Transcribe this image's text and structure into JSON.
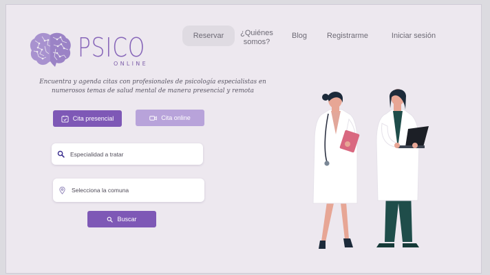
{
  "brand": {
    "name": "PSICO",
    "subtitle": "ONLINE"
  },
  "nav": {
    "reservar": "Reservar",
    "quienes_line1": "¿Quiénes",
    "quienes_line2": "somos?",
    "blog": "Blog",
    "registrarme": "Registrarme",
    "login": "Iniciar sesión"
  },
  "hero": {
    "tagline": "Encuentra y agenda citas con profesionales de psicología especialistas en numerosos temas de salud mental de manera presencial y remota"
  },
  "mode_buttons": {
    "presencial": "Cita presencial",
    "online": "Cita online"
  },
  "search": {
    "specialty_placeholder": "Especialidad a tratar",
    "commune_placeholder": "Selecciona la comuna",
    "button": "Buscar"
  },
  "colors": {
    "primary": "#7e58b6",
    "primary_light": "#b8a3da",
    "background": "#ede8ef"
  },
  "icons": [
    "brain-logo-icon",
    "calendar-icon",
    "video-camera-icon",
    "search-icon",
    "map-pin-icon"
  ]
}
